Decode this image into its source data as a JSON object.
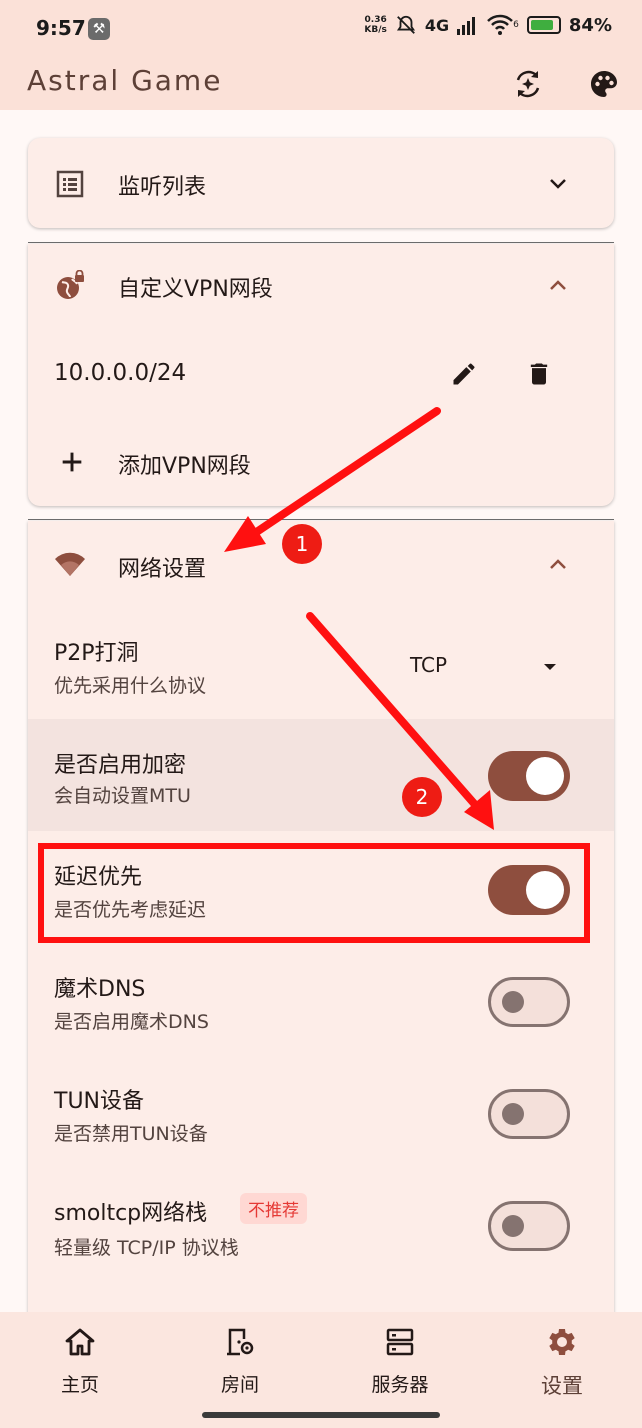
{
  "status_bar": {
    "time": "9:57",
    "speed_value": "0.36",
    "speed_unit": "KB/s",
    "network": "4G",
    "wifi_sub": "6",
    "battery": "84%"
  },
  "app_bar": {
    "title": "Astral Game"
  },
  "sections": {
    "listen_list": {
      "title": "监听列表"
    },
    "custom_vpn": {
      "title": "自定义VPN网段",
      "entry_value": "10.0.0.0/24",
      "add_label": "添加VPN网段"
    },
    "network_settings": {
      "title": "网络设置",
      "p2p": {
        "title": "P2P打洞",
        "subtitle": "优先采用什么协议",
        "selected": "TCP"
      },
      "encryption": {
        "title": "是否启用加密",
        "subtitle": "会自动设置MTU",
        "enabled": true
      },
      "latency_first": {
        "title": "延迟优先",
        "subtitle": "是否优先考虑延迟",
        "enabled": true
      },
      "magic_dns": {
        "title": "魔术DNS",
        "subtitle": "是否启用魔术DNS",
        "enabled": false
      },
      "tun_device": {
        "title": "TUN设备",
        "subtitle": "是否禁用TUN设备",
        "enabled": false
      },
      "smoltcp": {
        "title": "smoltcp网络栈",
        "badge": "不推荐",
        "subtitle": "轻量级 TCP/IP 协议栈",
        "enabled": false
      }
    }
  },
  "annotations": {
    "step1": "1",
    "step2": "2"
  },
  "bottom_nav": {
    "items": [
      {
        "label": "主页",
        "icon": "home-icon"
      },
      {
        "label": "房间",
        "icon": "room-icon"
      },
      {
        "label": "服务器",
        "icon": "server-icon"
      },
      {
        "label": "设置",
        "icon": "gear-icon",
        "active": true
      }
    ]
  },
  "colors": {
    "accent": "#8e4e3e",
    "surface": "#fdede8",
    "annotation_red": "#ff1010"
  }
}
